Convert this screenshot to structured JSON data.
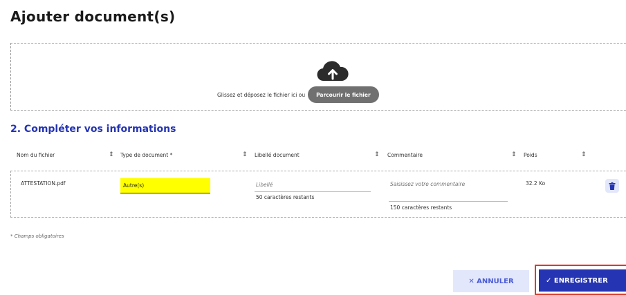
{
  "page_title": "Ajouter document(s)",
  "upload": {
    "icon": "cloud-upload-icon",
    "drop_text": "Glissez et déposez le fichier ici ou",
    "browse_label": "Parcourir le fichier"
  },
  "section_title": "2. Compléter vos informations",
  "table": {
    "columns": [
      "Nom du fichier",
      "Type de document *",
      "Libellé document",
      "Commentaire",
      "Poids"
    ],
    "sort_icon": "⇕",
    "row": {
      "filename": "ATTESTATION.pdf",
      "doc_type": "Autre(s)",
      "libelle_placeholder": "Libellé",
      "libelle_remaining": "50 caractères restants",
      "comment_placeholder": "Saisissez votre commentaire",
      "comment_remaining": "150 caractères restants",
      "weight": "32.2 Ko",
      "delete_icon": "trash-icon"
    }
  },
  "footnote": "* Champs obligatoires",
  "actions": {
    "cancel_label": "✕ ANNULER",
    "save_label": "✓ ENREGISTRER"
  },
  "colors": {
    "accent": "#2434b3",
    "highlight": "#ffff00",
    "cancel_bg": "#e3e7fb",
    "focus_frame": "#d93a2b"
  }
}
